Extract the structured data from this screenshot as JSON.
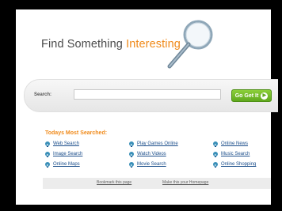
{
  "logo": {
    "text_main": "Find Something ",
    "text_accent": "Interesting"
  },
  "search": {
    "label": "Search:",
    "value": "",
    "placeholder": "",
    "button_label": "Go Get It"
  },
  "popular": {
    "heading": "Todays Most Searched:",
    "columns": [
      [
        "Web Search",
        "Image Search",
        "Online Maps"
      ],
      [
        "Play Games Online",
        "Watch Videos",
        "Movie Search"
      ],
      [
        "Online News",
        "Music Search",
        "Online Shopping"
      ]
    ]
  },
  "footer": {
    "bookmark": "Bookmark this page",
    "homepage": "Make this your Homepage"
  },
  "colors": {
    "accent": "#f08a1a",
    "link": "#1a4d8a",
    "button": "#6cb52a"
  }
}
